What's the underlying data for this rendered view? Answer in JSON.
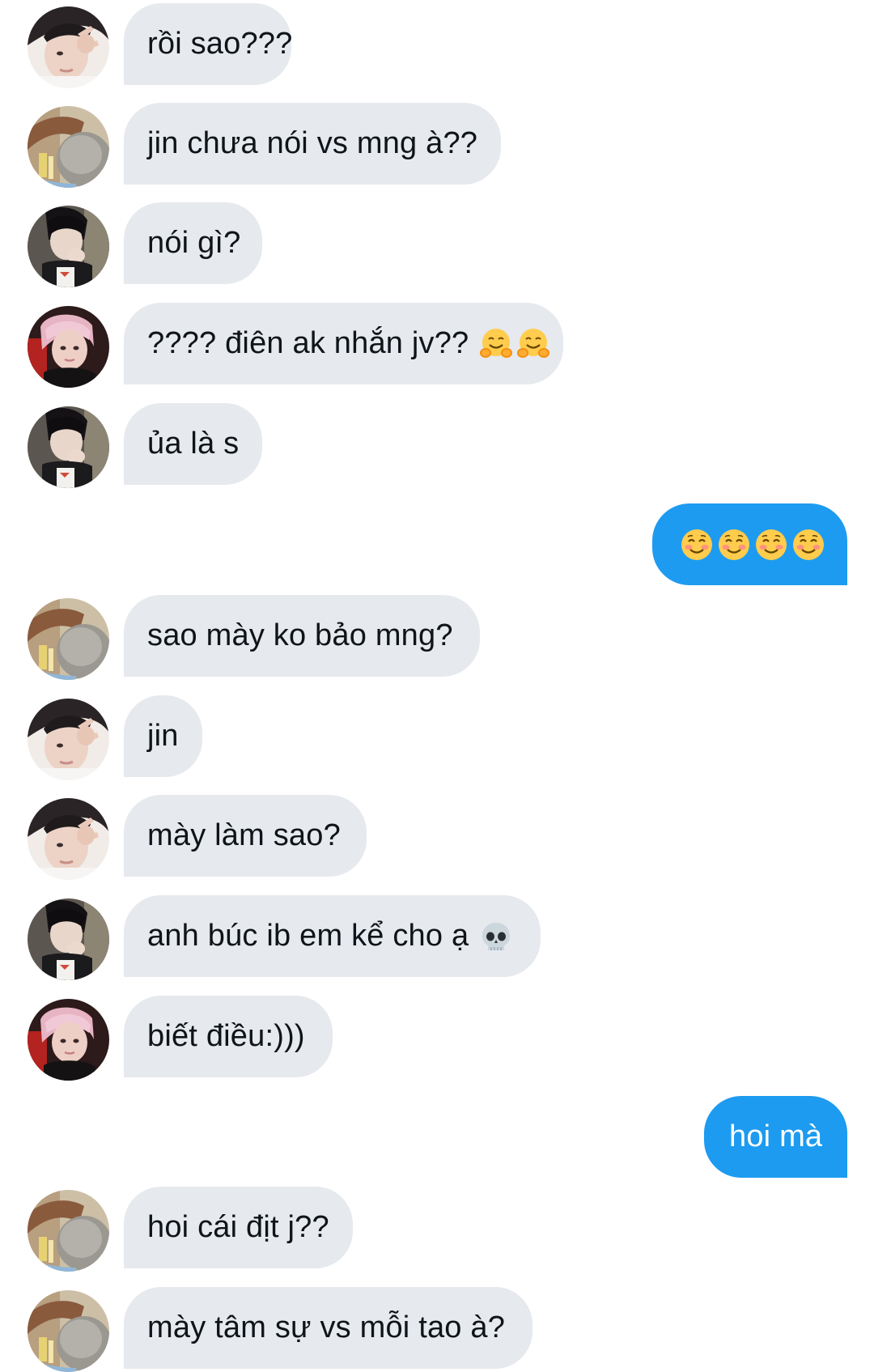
{
  "conversation": {
    "messages": [
      {
        "direction": "in",
        "sender_avatar": "avatar-peace-sign",
        "text": "rồi sao???"
      },
      {
        "direction": "in",
        "sender_avatar": "avatar-hat-cover",
        "text": "jin chưa nói vs mng à??"
      },
      {
        "direction": "in",
        "sender_avatar": "avatar-hand-chin",
        "text": "nói gì?"
      },
      {
        "direction": "in",
        "sender_avatar": "avatar-pink-hair",
        "text": "???? điên ak nhắn jv??",
        "emojis": [
          "hugging-face-emoji",
          "hugging-face-emoji"
        ]
      },
      {
        "direction": "in",
        "sender_avatar": "avatar-hand-chin",
        "text": "ủa là s"
      },
      {
        "direction": "out",
        "text": "",
        "emojis": [
          "smiling-face-emoji",
          "smiling-face-emoji",
          "smiling-face-emoji",
          "smiling-face-emoji"
        ]
      },
      {
        "direction": "in",
        "sender_avatar": "avatar-hat-cover",
        "text": "sao mày ko bảo mng?"
      },
      {
        "direction": "in",
        "sender_avatar": "avatar-peace-sign",
        "text": "jin"
      },
      {
        "direction": "in",
        "sender_avatar": "avatar-peace-sign",
        "text": "mày làm sao?"
      },
      {
        "direction": "in",
        "sender_avatar": "avatar-hand-chin",
        "text": "anh búc ib em kể cho ạ",
        "emojis": [
          "skull-emoji"
        ]
      },
      {
        "direction": "in",
        "sender_avatar": "avatar-pink-hair",
        "text": "biết điều:)))"
      },
      {
        "direction": "out",
        "text": "hoi mà"
      },
      {
        "direction": "in",
        "sender_avatar": "avatar-hat-cover",
        "text": "hoi cái địt j??"
      },
      {
        "direction": "in",
        "sender_avatar": "avatar-hat-cover",
        "text": "mày tâm sự vs mỗi tao à?"
      }
    ]
  },
  "colors": {
    "incoming_bubble": "#e6e9ed",
    "incoming_text": "#0f1419",
    "outgoing_bubble": "#1d9bf0",
    "outgoing_text": "#ffffff",
    "background": "#ffffff"
  }
}
